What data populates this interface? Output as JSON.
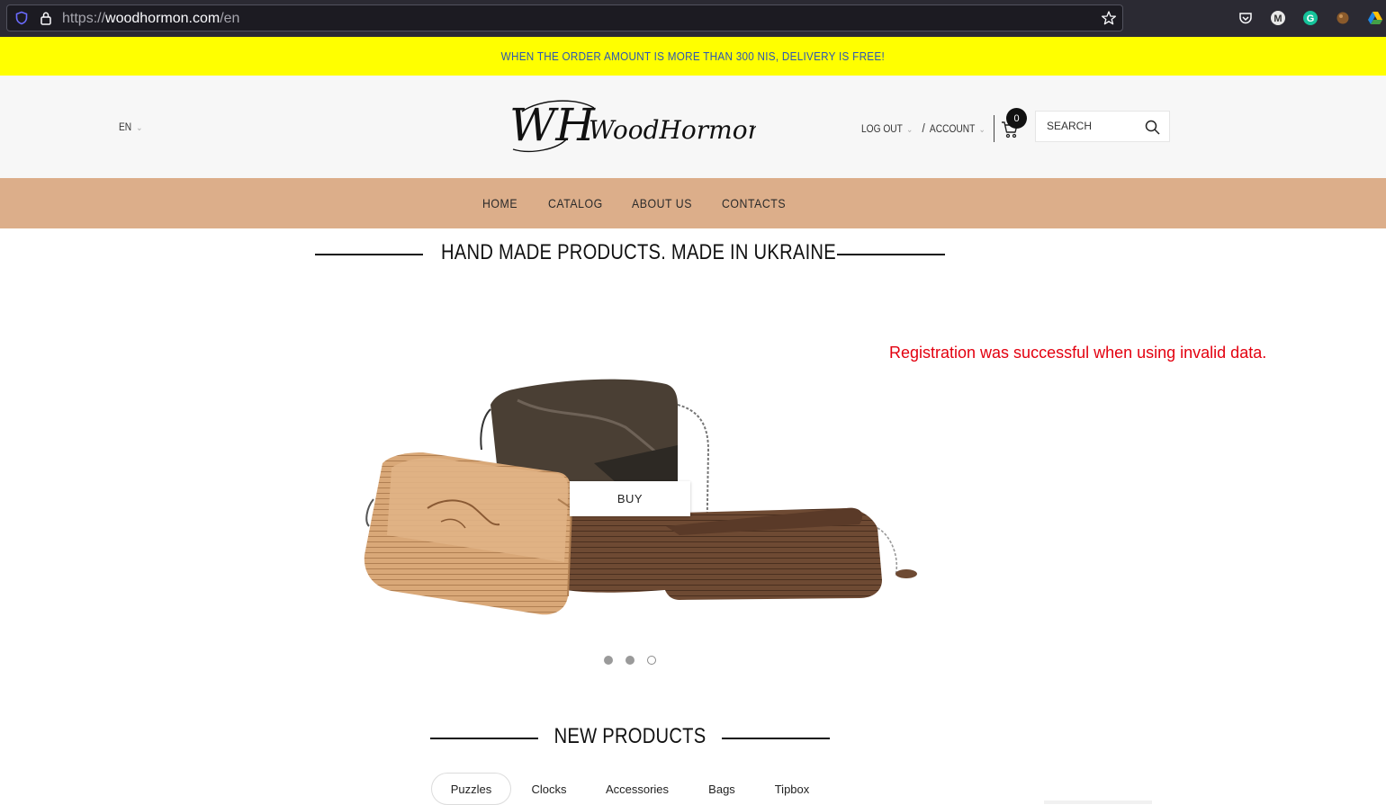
{
  "browser": {
    "url_scheme": "https://",
    "url_host": "woodhormon.com",
    "url_path": "/en",
    "extensions": [
      "pocket-icon",
      "m-extension-icon",
      "grammarly-icon",
      "extension-icon",
      "google-drive-icon"
    ]
  },
  "announcement": "WHEN THE ORDER AMOUNT IS MORE THAN 300 NIS, DELIVERY IS FREE!",
  "header": {
    "language": "EN",
    "logo_text": "WoodHormon",
    "logo_monogram": "WH",
    "logout_label": "LOG OUT",
    "account_label": "ACCOUNT",
    "separator": "/",
    "cart_count": "0",
    "search_placeholder": "SEARCH"
  },
  "nav": {
    "items": [
      "HOME",
      "CATALOG",
      "ABOUT US",
      "CONTACTS"
    ]
  },
  "hero": {
    "heading": "HAND MADE PRODUCTS. MADE IN UKRAINE",
    "buy_label": "BUY",
    "note": "Registration was successful when using invalid data.",
    "slide_count": 3,
    "active_slide": 2
  },
  "new_products": {
    "heading": "NEW PRODUCTS",
    "tabs": [
      "Puzzles",
      "Clocks",
      "Accessories",
      "Bags",
      "Tipbox"
    ],
    "active_tab": "Puzzles"
  },
  "colors": {
    "announcement_bg": "#ffff00",
    "announcement_text": "#2b56b4",
    "nav_bg": "#dcae8a",
    "note_text": "#e3000f"
  }
}
